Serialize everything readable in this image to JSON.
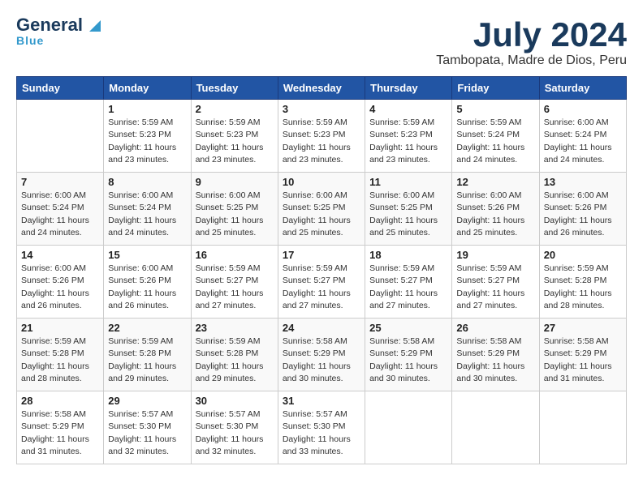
{
  "header": {
    "logo_general": "General",
    "logo_blue": "Blue",
    "month": "July 2024",
    "location": "Tambopata, Madre de Dios, Peru"
  },
  "days_of_week": [
    "Sunday",
    "Monday",
    "Tuesday",
    "Wednesday",
    "Thursday",
    "Friday",
    "Saturday"
  ],
  "weeks": [
    [
      {
        "day": "",
        "info": ""
      },
      {
        "day": "1",
        "info": "Sunrise: 5:59 AM\nSunset: 5:23 PM\nDaylight: 11 hours\nand 23 minutes."
      },
      {
        "day": "2",
        "info": "Sunrise: 5:59 AM\nSunset: 5:23 PM\nDaylight: 11 hours\nand 23 minutes."
      },
      {
        "day": "3",
        "info": "Sunrise: 5:59 AM\nSunset: 5:23 PM\nDaylight: 11 hours\nand 23 minutes."
      },
      {
        "day": "4",
        "info": "Sunrise: 5:59 AM\nSunset: 5:23 PM\nDaylight: 11 hours\nand 23 minutes."
      },
      {
        "day": "5",
        "info": "Sunrise: 5:59 AM\nSunset: 5:24 PM\nDaylight: 11 hours\nand 24 minutes."
      },
      {
        "day": "6",
        "info": "Sunrise: 6:00 AM\nSunset: 5:24 PM\nDaylight: 11 hours\nand 24 minutes."
      }
    ],
    [
      {
        "day": "7",
        "info": "Sunrise: 6:00 AM\nSunset: 5:24 PM\nDaylight: 11 hours\nand 24 minutes."
      },
      {
        "day": "8",
        "info": "Sunrise: 6:00 AM\nSunset: 5:24 PM\nDaylight: 11 hours\nand 24 minutes."
      },
      {
        "day": "9",
        "info": "Sunrise: 6:00 AM\nSunset: 5:25 PM\nDaylight: 11 hours\nand 25 minutes."
      },
      {
        "day": "10",
        "info": "Sunrise: 6:00 AM\nSunset: 5:25 PM\nDaylight: 11 hours\nand 25 minutes."
      },
      {
        "day": "11",
        "info": "Sunrise: 6:00 AM\nSunset: 5:25 PM\nDaylight: 11 hours\nand 25 minutes."
      },
      {
        "day": "12",
        "info": "Sunrise: 6:00 AM\nSunset: 5:26 PM\nDaylight: 11 hours\nand 25 minutes."
      },
      {
        "day": "13",
        "info": "Sunrise: 6:00 AM\nSunset: 5:26 PM\nDaylight: 11 hours\nand 26 minutes."
      }
    ],
    [
      {
        "day": "14",
        "info": "Sunrise: 6:00 AM\nSunset: 5:26 PM\nDaylight: 11 hours\nand 26 minutes."
      },
      {
        "day": "15",
        "info": "Sunrise: 6:00 AM\nSunset: 5:26 PM\nDaylight: 11 hours\nand 26 minutes."
      },
      {
        "day": "16",
        "info": "Sunrise: 5:59 AM\nSunset: 5:27 PM\nDaylight: 11 hours\nand 27 minutes."
      },
      {
        "day": "17",
        "info": "Sunrise: 5:59 AM\nSunset: 5:27 PM\nDaylight: 11 hours\nand 27 minutes."
      },
      {
        "day": "18",
        "info": "Sunrise: 5:59 AM\nSunset: 5:27 PM\nDaylight: 11 hours\nand 27 minutes."
      },
      {
        "day": "19",
        "info": "Sunrise: 5:59 AM\nSunset: 5:27 PM\nDaylight: 11 hours\nand 27 minutes."
      },
      {
        "day": "20",
        "info": "Sunrise: 5:59 AM\nSunset: 5:28 PM\nDaylight: 11 hours\nand 28 minutes."
      }
    ],
    [
      {
        "day": "21",
        "info": "Sunrise: 5:59 AM\nSunset: 5:28 PM\nDaylight: 11 hours\nand 28 minutes."
      },
      {
        "day": "22",
        "info": "Sunrise: 5:59 AM\nSunset: 5:28 PM\nDaylight: 11 hours\nand 29 minutes."
      },
      {
        "day": "23",
        "info": "Sunrise: 5:59 AM\nSunset: 5:28 PM\nDaylight: 11 hours\nand 29 minutes."
      },
      {
        "day": "24",
        "info": "Sunrise: 5:58 AM\nSunset: 5:29 PM\nDaylight: 11 hours\nand 30 minutes."
      },
      {
        "day": "25",
        "info": "Sunrise: 5:58 AM\nSunset: 5:29 PM\nDaylight: 11 hours\nand 30 minutes."
      },
      {
        "day": "26",
        "info": "Sunrise: 5:58 AM\nSunset: 5:29 PM\nDaylight: 11 hours\nand 30 minutes."
      },
      {
        "day": "27",
        "info": "Sunrise: 5:58 AM\nSunset: 5:29 PM\nDaylight: 11 hours\nand 31 minutes."
      }
    ],
    [
      {
        "day": "28",
        "info": "Sunrise: 5:58 AM\nSunset: 5:29 PM\nDaylight: 11 hours\nand 31 minutes."
      },
      {
        "day": "29",
        "info": "Sunrise: 5:57 AM\nSunset: 5:30 PM\nDaylight: 11 hours\nand 32 minutes."
      },
      {
        "day": "30",
        "info": "Sunrise: 5:57 AM\nSunset: 5:30 PM\nDaylight: 11 hours\nand 32 minutes."
      },
      {
        "day": "31",
        "info": "Sunrise: 5:57 AM\nSunset: 5:30 PM\nDaylight: 11 hours\nand 33 minutes."
      },
      {
        "day": "",
        "info": ""
      },
      {
        "day": "",
        "info": ""
      },
      {
        "day": "",
        "info": ""
      }
    ]
  ]
}
